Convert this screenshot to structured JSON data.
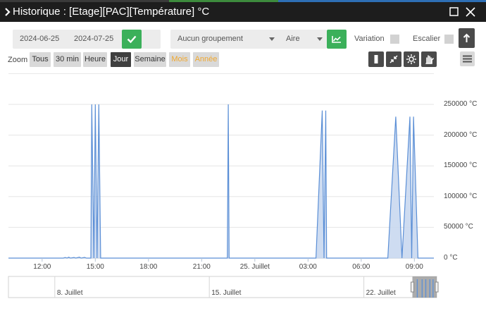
{
  "window": {
    "title": "Historique : [Etage][PAC][Température] °C",
    "chevron_icon": "chevron-right-icon",
    "maximize_icon": "maximize-icon",
    "close_icon": "close-icon"
  },
  "controls": {
    "date_start": "2024-06-25",
    "date_end": "2024-07-25",
    "validate_icon": "check-icon",
    "grouping": "Aucun groupement",
    "chart_type": "Aire",
    "chart_type_icon": "line-chart-icon",
    "variation_label": "Variation",
    "variation_checked": false,
    "escalier_label": "Escalier",
    "escalier_checked": false,
    "up_icon": "arrow-up-icon"
  },
  "zoom": {
    "label": "Zoom",
    "buttons": [
      {
        "label": "Tous",
        "state": "normal"
      },
      {
        "label": "30 min",
        "state": "normal"
      },
      {
        "label": "Heure",
        "state": "normal"
      },
      {
        "label": "Jour",
        "state": "active"
      },
      {
        "label": "Semaine",
        "state": "normal"
      },
      {
        "label": "Mois",
        "state": "disabled"
      },
      {
        "label": "Année",
        "state": "disabled"
      }
    ],
    "tools": [
      "bar-icon",
      "compress-icon",
      "settings-icon",
      "hand-icon"
    ],
    "menu_icon": "hamburger-menu-icon"
  },
  "colors": {
    "series": "#5b8fd6",
    "series_fill": "#c5d6ef",
    "accent_green": "#3bb05a",
    "disabled_orange": "#f0a830"
  },
  "chart_data": {
    "type": "area",
    "yunit": "°C",
    "ylim": [
      0,
      250000
    ],
    "ytick_labels": [
      "250000 °C",
      "200000 °C",
      "150000 °C",
      "100000 °C",
      "50000 °C",
      "0 °C"
    ],
    "ytick_values": [
      250000,
      200000,
      150000,
      100000,
      50000,
      0
    ],
    "x_labels": [
      "12:00",
      "15:00",
      "18:00",
      "21:00",
      "25. Juillet",
      "03:00",
      "06:00",
      "09:00"
    ],
    "x_label_hours": [
      12,
      15,
      18,
      21,
      24,
      27,
      30,
      33
    ],
    "xlim_hours": [
      10.1,
      34.1
    ],
    "series": [
      {
        "points": [
          [
            10.1,
            0
          ],
          [
            13.2,
            0
          ],
          [
            13.3,
            1000
          ],
          [
            13.4,
            0
          ],
          [
            13.5,
            1500
          ],
          [
            13.6,
            0
          ],
          [
            13.8,
            1000
          ],
          [
            13.9,
            0
          ],
          [
            14.1,
            1500
          ],
          [
            14.2,
            0
          ],
          [
            14.4,
            1200
          ],
          [
            14.5,
            0
          ],
          [
            14.75,
            0
          ],
          [
            14.8,
            250000
          ],
          [
            14.92,
            0
          ],
          [
            15.0,
            250000
          ],
          [
            15.1,
            0
          ],
          [
            15.2,
            250000
          ],
          [
            15.3,
            0
          ],
          [
            22.45,
            0
          ],
          [
            22.5,
            250000
          ],
          [
            22.55,
            0
          ],
          [
            27.45,
            0
          ],
          [
            27.8,
            240000
          ],
          [
            27.9,
            0
          ],
          [
            28.0,
            240000
          ],
          [
            28.05,
            0
          ],
          [
            31.5,
            0
          ],
          [
            31.95,
            230000
          ],
          [
            32.3,
            0
          ],
          [
            32.75,
            230000
          ],
          [
            32.85,
            0
          ],
          [
            32.95,
            230000
          ],
          [
            33.2,
            0
          ],
          [
            34.1,
            0
          ]
        ]
      }
    ],
    "navigator": {
      "labels": [
        "8. Juillet",
        "15. Juillet",
        "22. Juillet"
      ],
      "label_days": [
        8,
        15,
        22
      ],
      "xlim_days": [
        5.9,
        25.3
      ],
      "selected_days": [
        24.2,
        25.3
      ]
    }
  }
}
